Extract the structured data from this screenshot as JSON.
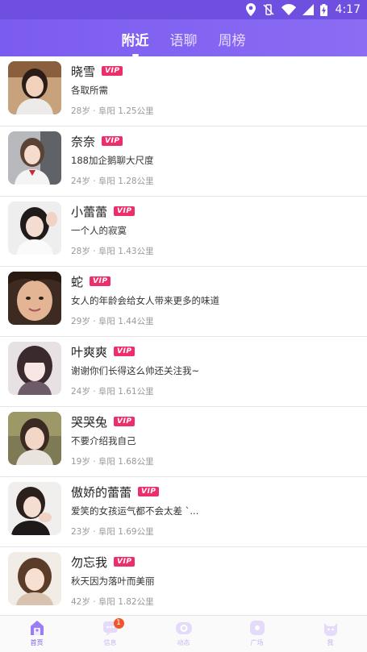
{
  "status_bar": {
    "time": "4:17",
    "icons": [
      "location-icon",
      "vibrate-off-icon",
      "wifi-icon",
      "signal-icon",
      "battery-charging-icon"
    ]
  },
  "header": {
    "tabs": [
      {
        "label": "附近",
        "active": true
      },
      {
        "label": "语聊",
        "active": false
      },
      {
        "label": "周榜",
        "active": false
      }
    ]
  },
  "users": [
    {
      "name": "晓雪",
      "vip": "VIP",
      "signature": "各取所需",
      "meta": "28岁 · 阜阳 1.25公里"
    },
    {
      "name": "奈奈",
      "vip": "VIP",
      "signature": "188加企鹅聊大尺度",
      "meta": "24岁 · 阜阳 1.28公里"
    },
    {
      "name": "小蕾蕾",
      "vip": "VIP",
      "signature": "一个人的寂寞",
      "meta": "28岁 · 阜阳 1.43公里"
    },
    {
      "name": "蛇",
      "vip": "VIP",
      "signature": "女人的年龄会给女人带来更多的味道",
      "meta": "29岁 · 阜阳 1.44公里"
    },
    {
      "name": "叶爽爽",
      "vip": "VIP",
      "signature": "谢谢你们长得这么帅还关注我~",
      "meta": "24岁 · 阜阳 1.61公里"
    },
    {
      "name": "哭哭兔",
      "vip": "VIP",
      "signature": "不要介绍我自己",
      "meta": "19岁 · 阜阳 1.68公里"
    },
    {
      "name": "傲娇的蕾蕾",
      "vip": "VIP",
      "signature": "爱笑的女孩运气都不会太差 `...",
      "meta": "23岁 · 阜阳 1.69公里"
    },
    {
      "name": "勿忘我",
      "vip": "VIP",
      "signature": "秋天因为落叶而美丽",
      "meta": "42岁 · 阜阳 1.82公里"
    }
  ],
  "bottom_nav": [
    {
      "label": "首页",
      "icon": "home-icon",
      "active": true,
      "badge": ""
    },
    {
      "label": "信息",
      "icon": "message-icon",
      "active": false,
      "badge": "1"
    },
    {
      "label": "动态",
      "icon": "moments-icon",
      "active": false,
      "badge": ""
    },
    {
      "label": "广场",
      "icon": "square-icon",
      "active": false,
      "badge": ""
    },
    {
      "label": "我",
      "icon": "profile-icon",
      "active": false,
      "badge": ""
    }
  ],
  "colors": {
    "brand": "#7b5cf0",
    "vip": "#ee2e6b",
    "badge": "#f0562e"
  }
}
